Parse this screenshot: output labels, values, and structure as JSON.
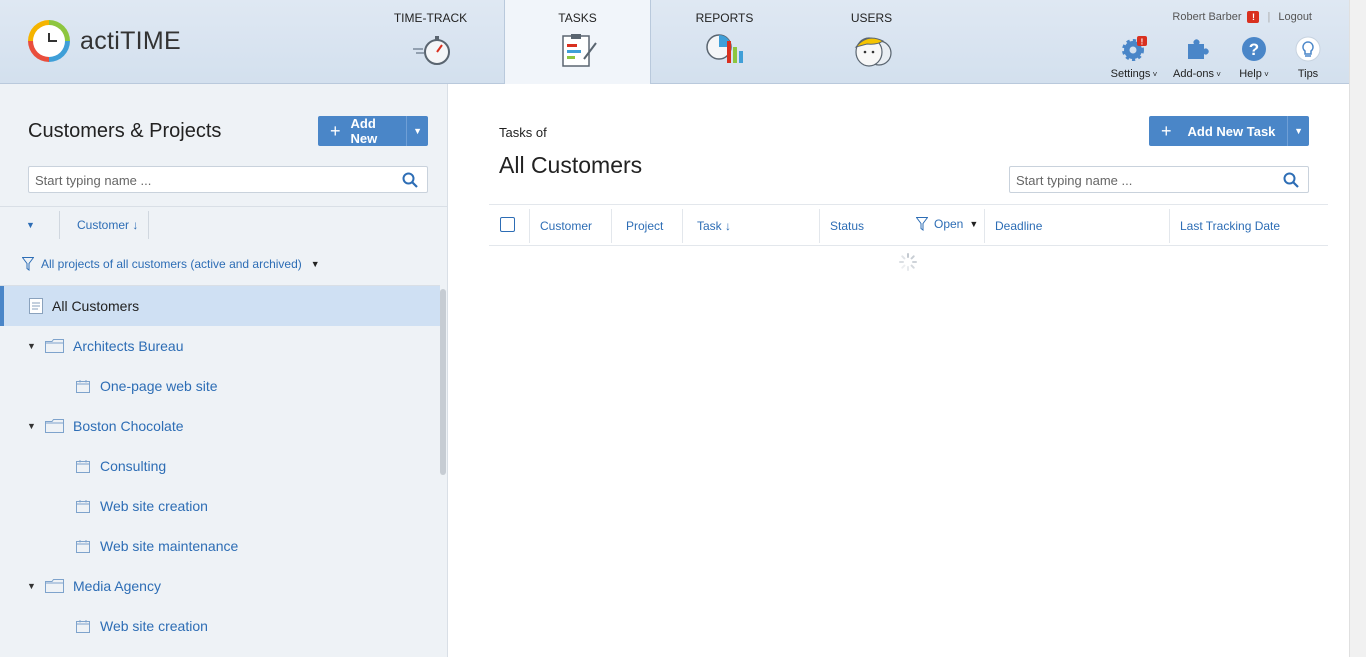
{
  "app": {
    "logo_text": "actiTIME"
  },
  "nav": {
    "tabs": [
      {
        "label": "TIME-TRACK",
        "icon": "stopwatch-icon",
        "active": false
      },
      {
        "label": "TASKS",
        "icon": "tasks-clipboard-icon",
        "active": true
      },
      {
        "label": "REPORTS",
        "icon": "reports-chart-icon",
        "active": false
      },
      {
        "label": "USERS",
        "icon": "users-face-icon",
        "active": false
      }
    ]
  },
  "user": {
    "name": "Robert Barber",
    "alert_badge": "!",
    "logout": "Logout"
  },
  "tools": {
    "settings": {
      "label": "Settings",
      "icon": "gear-icon",
      "badge": "!"
    },
    "addons": {
      "label": "Add-ons",
      "icon": "puzzle-icon"
    },
    "help": {
      "label": "Help",
      "icon": "question-icon"
    },
    "tips": {
      "label": "Tips",
      "icon": "lightbulb-icon"
    }
  },
  "left_panel": {
    "title": "Customers & Projects",
    "add_new_label": "Add New",
    "search_placeholder": "Start typing name ...",
    "column_customer": "Customer",
    "sort_arrow": "↓",
    "filter_text": "All projects of all customers (active and archived)",
    "tree": {
      "all_customers": "All Customers",
      "customers": [
        {
          "name": "Architects Bureau",
          "projects": [
            "One-page web site"
          ]
        },
        {
          "name": "Boston Chocolate",
          "projects": [
            "Consulting",
            "Web site creation",
            "Web site maintenance"
          ]
        },
        {
          "name": "Media Agency",
          "projects": [
            "Web site creation"
          ]
        }
      ]
    }
  },
  "right_panel": {
    "tasks_of": "Tasks of",
    "title": "All Customers",
    "add_task_label": "Add New Task",
    "search_placeholder": "Start typing name ...",
    "columns": {
      "customer": "Customer",
      "project": "Project",
      "task": "Task",
      "task_sort": "↓",
      "status": "Status",
      "status_filter": "Open",
      "deadline": "Deadline",
      "last_tracking": "Last Tracking Date"
    }
  },
  "colors": {
    "accent": "#4a86c8",
    "link": "#2d6db5",
    "selected_row": "#cfe0f3"
  }
}
